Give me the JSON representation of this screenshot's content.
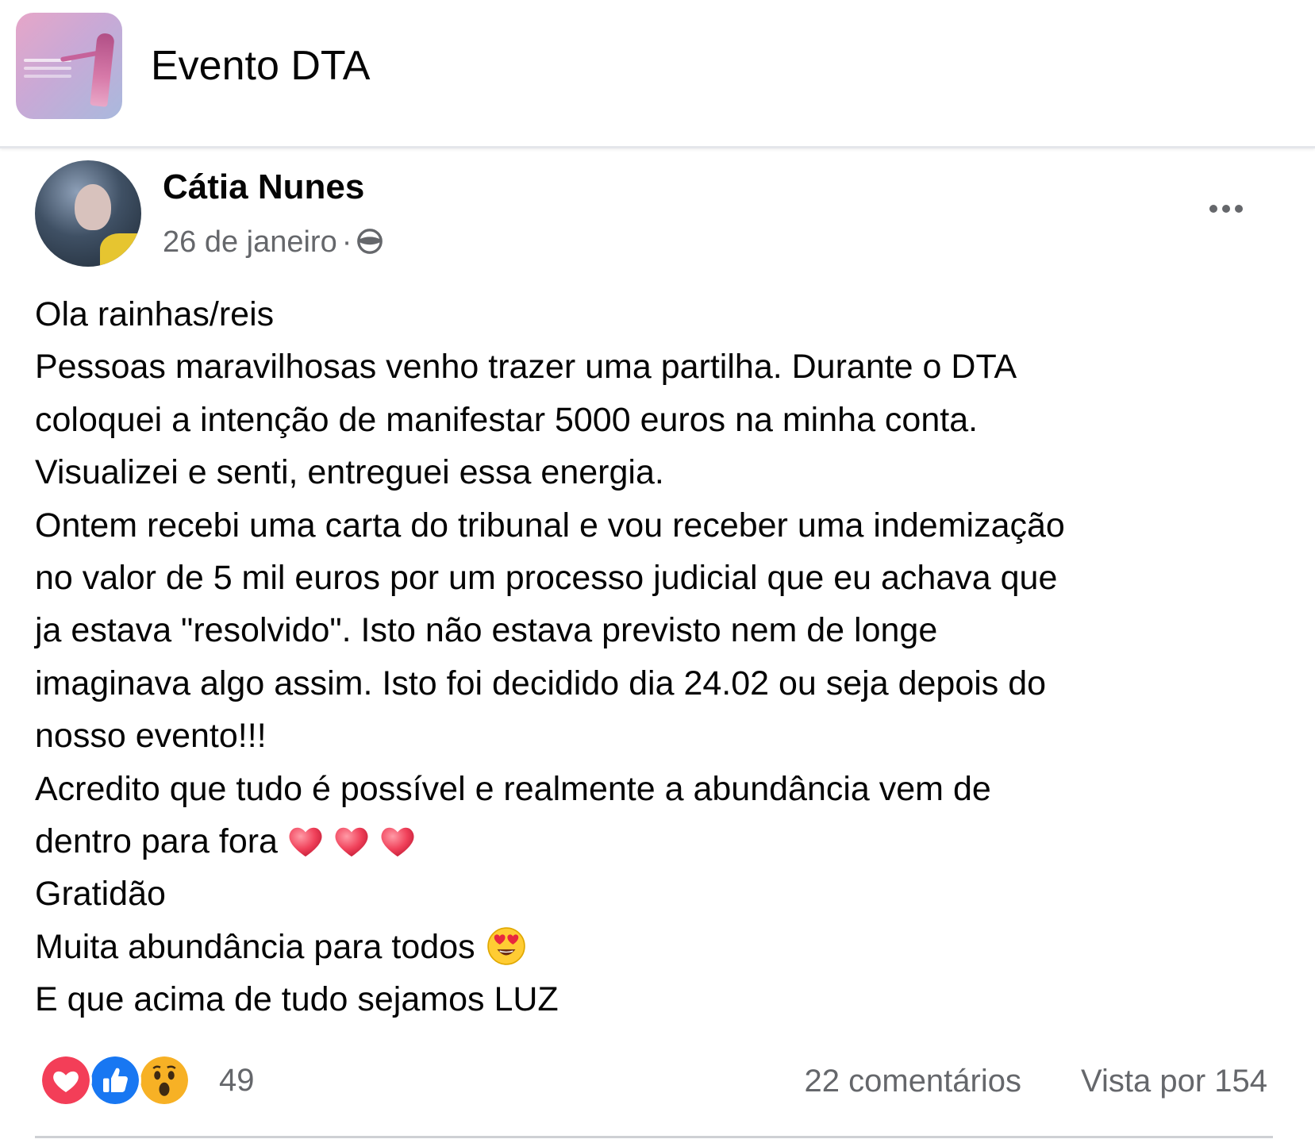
{
  "group": {
    "name": "Evento DTA"
  },
  "post": {
    "author": "Cátia Nunes",
    "date": "26 de janeiro",
    "separator": "·",
    "visibility_icon": "globe-icon",
    "more_icon": "more-options-icon",
    "lines": [
      "Ola rainhas/reis",
      "Pessoas maravilhosas venho trazer uma partilha. Durante o DTA",
      "coloquei a intenção de manifestar 5000 euros na minha conta.",
      "Visualizei e senti, entreguei essa energia.",
      "Ontem recebi uma carta do tribunal e vou receber uma indemização",
      "no valor de 5 mil euros por um processo judicial que eu achava que",
      "ja estava \"resolvido\". Isto não estava previsto nem de longe",
      "imaginava algo assim. Isto foi decidido dia 24.02 ou seja depois do",
      "nosso evento!!!",
      "Acredito que tudo é possível  e realmente a abundância vem de",
      "dentro para fora",
      "Gratidão",
      "Muita abundância para todos",
      "E que acima de tudo sejamos LUZ"
    ],
    "inline_emojis": {
      "line_10": [
        "heart-emoji",
        "heart-emoji",
        "heart-emoji"
      ],
      "line_12": [
        "heart-eyes-emoji"
      ]
    }
  },
  "footer": {
    "reaction_icons": [
      "love-reaction-icon",
      "like-reaction-icon",
      "wow-reaction-icon"
    ],
    "reaction_count": "49",
    "comments": "22 comentários",
    "views": "Vista por 154"
  },
  "colors": {
    "text_primary": "#050505",
    "text_secondary": "#65676b",
    "like_blue": "#1877f2",
    "love_red": "#f33e58",
    "wow_yellow": "#f7b125",
    "divider": "#ced0d4"
  }
}
